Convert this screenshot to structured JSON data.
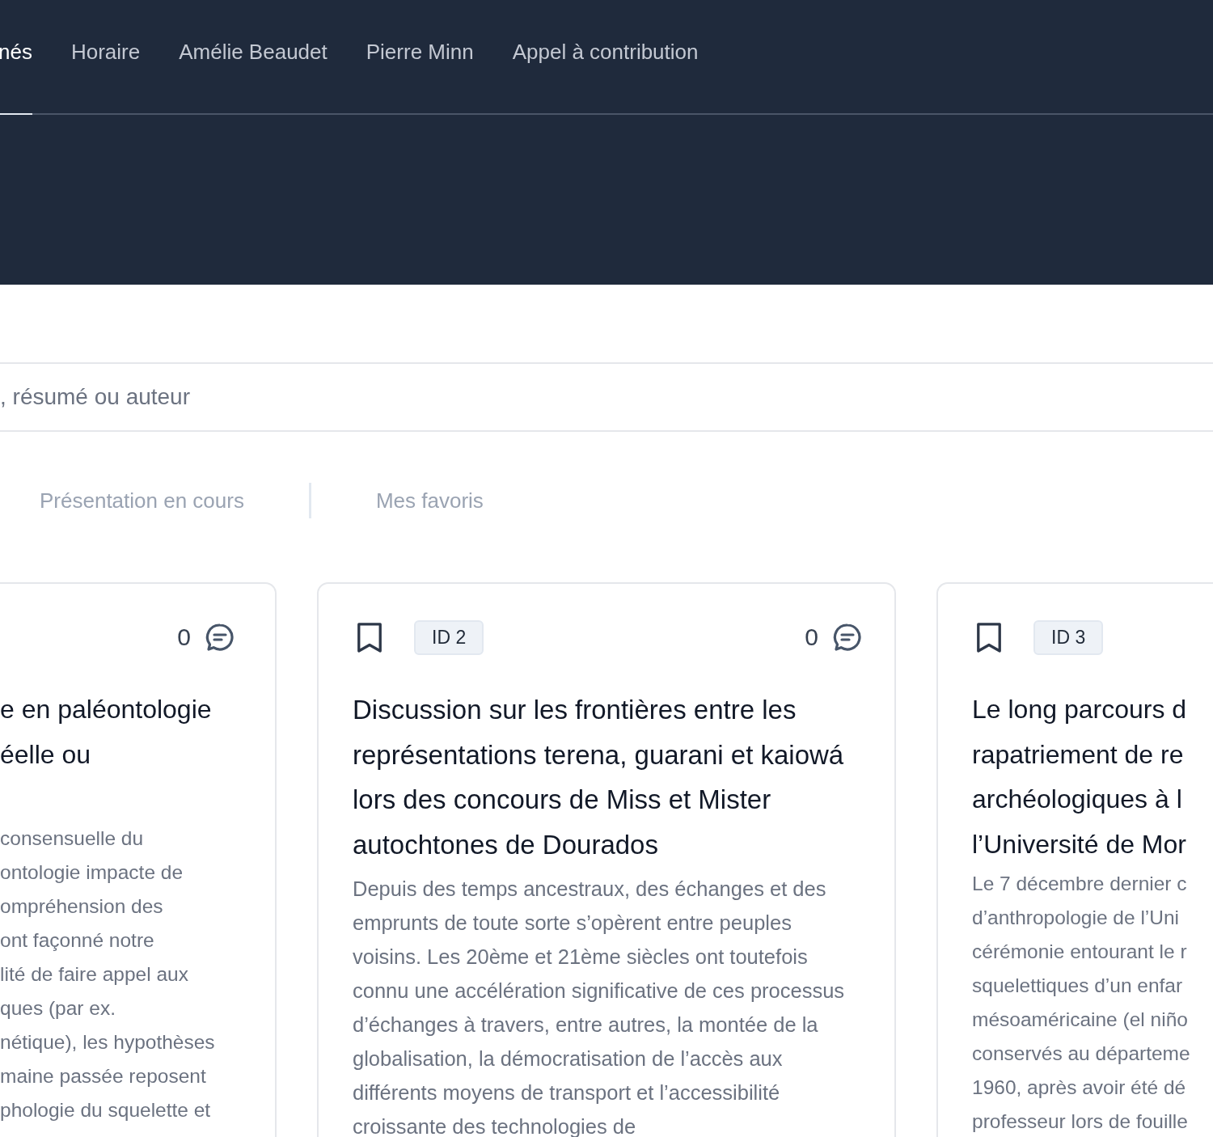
{
  "nav": {
    "items": [
      {
        "label": "nés",
        "selected": true
      },
      {
        "label": "Horaire",
        "selected": false
      },
      {
        "label": "Amélie Beaudet",
        "selected": false
      },
      {
        "label": "Pierre Minn",
        "selected": false
      },
      {
        "label": "Appel à contribution",
        "selected": false
      }
    ]
  },
  "search": {
    "placeholder": ", résumé ou auteur"
  },
  "tabs": [
    {
      "label": "Présentation en cours",
      "selected": false
    },
    {
      "label": "Mes favoris",
      "selected": false
    }
  ],
  "cards": [
    {
      "comments": "0",
      "title_lines": [
        "e en paléontologie",
        "éelle ou"
      ],
      "description_lines": [
        "consensuelle du",
        "ontologie impacte de",
        "ompréhension des",
        "ont façonné notre",
        "lité de faire appel aux",
        "ques (par ex.",
        "nétique), les hypothèses",
        "maine passée reposent",
        "phologie du squelette et"
      ]
    },
    {
      "id_badge": "ID 2",
      "comments": "0",
      "title": "Discussion sur les frontières entre les représentations terena, guarani et kaiowá lors des concours de Miss et Mister autochtones de Dourados",
      "description": "Depuis des temps ancestraux, des échanges et des emprunts de toute sorte s’opèrent entre peuples voisins. Les 20ème et 21ème siècles ont toutefois connu une accélération significative de ces processus d’échanges à travers, entre autres, la montée de la globalisation, la démocratisation de l’accès aux différents moyens de transport et l’accessibilité croissante des technologies de"
    },
    {
      "id_badge": "ID 3",
      "title_lines": [
        "Le long parcours d",
        "rapatriement de re",
        "archéologiques à l",
        "l’Université de Mor"
      ],
      "description_lines": [
        "Le 7 décembre dernier c",
        "d’anthropologie de l’Uni",
        "cérémonie entourant le r",
        "squelettiques d’un enfar",
        "mésoaméricaine (el niño",
        "conservés au départeme",
        "1960, après avoir été dé",
        "professeur lors de fouille"
      ]
    }
  ]
}
